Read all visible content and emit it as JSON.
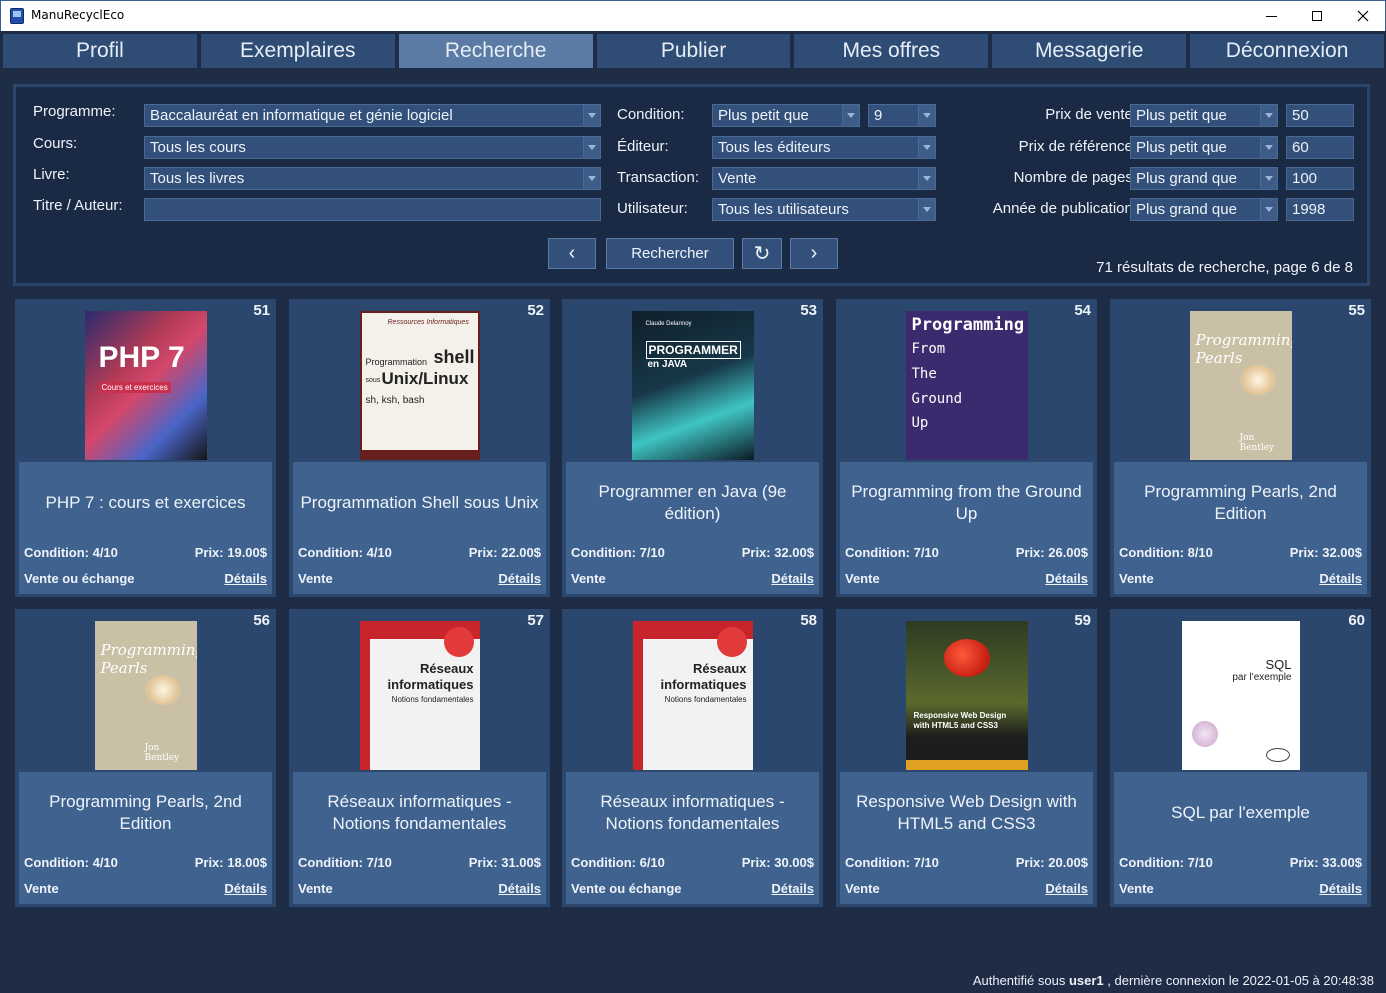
{
  "window": {
    "title": "ManuRecyclEco"
  },
  "nav": {
    "tabs": [
      {
        "label": "Profil",
        "active": false
      },
      {
        "label": "Exemplaires",
        "active": false
      },
      {
        "label": "Recherche",
        "active": true
      },
      {
        "label": "Publier",
        "active": false
      },
      {
        "label": "Mes offres",
        "active": false
      },
      {
        "label": "Messagerie",
        "active": false
      },
      {
        "label": "Déconnexion",
        "active": false
      }
    ]
  },
  "filters": {
    "programme_label": "Programme:",
    "programme_value": "Baccalauréat en informatique et génie logiciel",
    "cours_label": "Cours:",
    "cours_value": "Tous les cours",
    "livre_label": "Livre:",
    "livre_value": "Tous les livres",
    "titre_label": "Titre / Auteur:",
    "titre_value": "",
    "condition_label": "Condition:",
    "condition_op": "Plus petit que",
    "condition_value": "9",
    "editeur_label": "Éditeur:",
    "editeur_value": "Tous les éditeurs",
    "transaction_label": "Transaction:",
    "transaction_value": "Vente",
    "utilisateur_label": "Utilisateur:",
    "utilisateur_value": "Tous les utilisateurs",
    "prix_vente_label": "Prix de vente:",
    "prix_vente_op": "Plus petit que",
    "prix_vente_value": "50",
    "prix_ref_label": "Prix de référence:",
    "prix_ref_op": "Plus petit que",
    "prix_ref_value": "60",
    "pages_label": "Nombre de pages:",
    "pages_op": "Plus grand que",
    "pages_value": "100",
    "annee_label": "Année de publication:",
    "annee_op": "Plus grand que",
    "annee_value": "1998"
  },
  "actions": {
    "prev": "‹",
    "search": "Rechercher",
    "reset": "↻",
    "next": "›",
    "results": "71 résultats de recherche, page 6 de 8"
  },
  "cards": [
    {
      "num": "51",
      "title": "PHP 7 : cours et exercices",
      "condition": "Condition: 4/10",
      "price": "Prix: 19.00$",
      "transaction": "Vente ou échange",
      "details": "Détails"
    },
    {
      "num": "52",
      "title": "Programmation Shell sous Unix",
      "condition": "Condition: 4/10",
      "price": "Prix: 22.00$",
      "transaction": "Vente",
      "details": "Détails"
    },
    {
      "num": "53",
      "title": "Programmer en Java (9e édition)",
      "condition": "Condition: 7/10",
      "price": "Prix: 32.00$",
      "transaction": "Vente",
      "details": "Détails"
    },
    {
      "num": "54",
      "title": "Programming from the Ground Up",
      "condition": "Condition: 7/10",
      "price": "Prix: 26.00$",
      "transaction": "Vente",
      "details": "Détails"
    },
    {
      "num": "55",
      "title": "Programming Pearls, 2nd Edition",
      "condition": "Condition: 8/10",
      "price": "Prix: 32.00$",
      "transaction": "Vente",
      "details": "Détails"
    },
    {
      "num": "56",
      "title": "Programming Pearls, 2nd Edition",
      "condition": "Condition: 4/10",
      "price": "Prix: 18.00$",
      "transaction": "Vente",
      "details": "Détails"
    },
    {
      "num": "57",
      "title": "Réseaux informatiques - Notions fondamentales",
      "condition": "Condition: 7/10",
      "price": "Prix: 31.00$",
      "transaction": "Vente",
      "details": "Détails"
    },
    {
      "num": "58",
      "title": "Réseaux informatiques - Notions fondamentales",
      "condition": "Condition: 6/10",
      "price": "Prix: 30.00$",
      "transaction": "Vente ou échange",
      "details": "Détails"
    },
    {
      "num": "59",
      "title": "Responsive Web Design with HTML5 and CSS3",
      "condition": "Condition: 7/10",
      "price": "Prix: 20.00$",
      "transaction": "Vente",
      "details": "Détails"
    },
    {
      "num": "60",
      "title": "SQL par l'exemple",
      "condition": "Condition: 7/10",
      "price": "Prix: 33.00$",
      "transaction": "Vente",
      "details": "Détails"
    }
  ],
  "covers": {
    "php": {
      "title": "PHP 7",
      "sub": "Cours et exercices"
    },
    "shell": {
      "top": "Ressources Informatiques",
      "l1": "Programmation",
      "l2": "shell",
      "l3": "sous",
      "l4": "Unix/Linux",
      "l5": "sh, ksh, bash"
    },
    "java": {
      "top": "Claude Delannoy",
      "l1": "PROGRAMMER",
      "l2": "en JAVA"
    },
    "ground": {
      "l1": "Programming",
      "l2": "From",
      "l3": "The",
      "l4": "Ground",
      "l5": "Up"
    },
    "pearls": {
      "l1": "Programming",
      "l2": "Pearls",
      "author": "Jon Bentley"
    },
    "reseaux": {
      "l1": "Réseaux",
      "l2": "informatiques",
      "l3": "Notions fondamentales"
    },
    "rwd": {
      "l1": "Responsive Web Design",
      "l2": "with HTML5 and CSS3"
    },
    "sql": {
      "l1": "SQL",
      "l2": "par l'exemple"
    }
  },
  "status": {
    "prefix": "Authentifié sous",
    "user": "user1",
    "suffix": ", dernière connexion le 2022-01-05 à 20:48:38"
  }
}
